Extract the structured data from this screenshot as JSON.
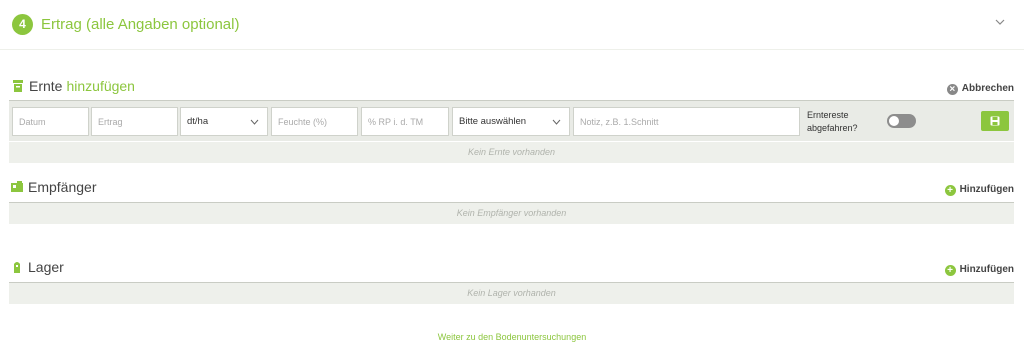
{
  "header": {
    "step_number": "4",
    "title": "Ertrag (alle Angaben optional)"
  },
  "ernte": {
    "title": "Ernte",
    "title_accent": "hinzufügen",
    "cancel_label": "Abbrechen",
    "fields": {
      "datum_placeholder": "Datum",
      "ertrag_placeholder": "Ertrag",
      "unit_value": "dt/ha",
      "feuchte_placeholder": "Feuchte (%)",
      "rp_placeholder": "% RP i. d. TM",
      "select_value": "Bitte auswählen",
      "notiz_placeholder": "Notiz, z.B. 1.Schnitt"
    },
    "toggle_label_line1": "Erntereste",
    "toggle_label_line2": "abgefahren?",
    "toggle_on": false,
    "empty_text": "Kein Ernte vorhanden"
  },
  "empfaenger": {
    "title": "Empfänger",
    "add_label": "Hinzufügen",
    "empty_text": "Kein Empfänger vorhanden"
  },
  "lager": {
    "title": "Lager",
    "add_label": "Hinzufügen",
    "empty_text": "Kein Lager vorhanden"
  },
  "footer": {
    "link_text": "Weiter zu den Bodenuntersuchungen"
  },
  "colors": {
    "accent": "#8cc63e",
    "toggle_off": "#8d8d8d"
  }
}
